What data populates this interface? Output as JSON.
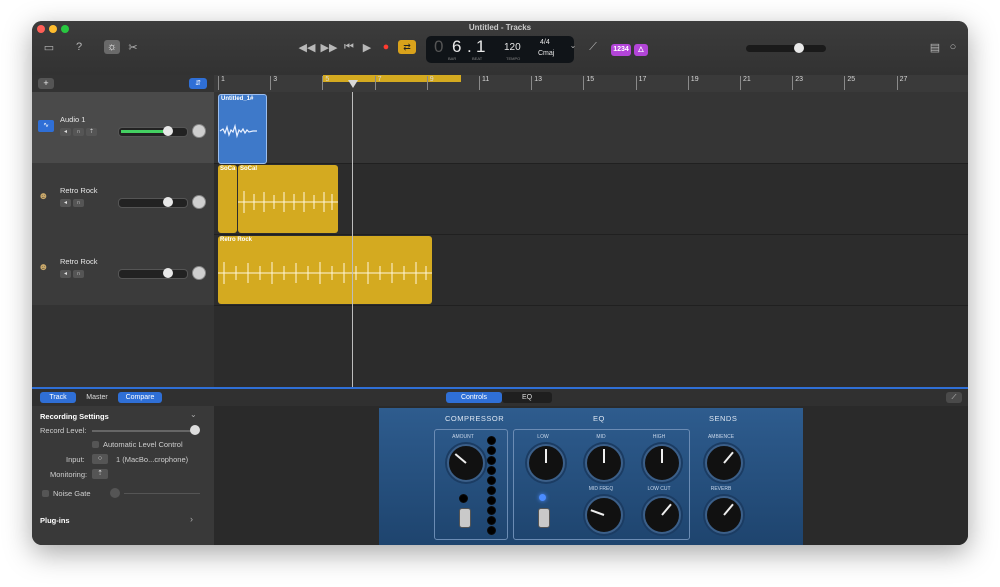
{
  "window": {
    "title": "Untitled - Tracks"
  },
  "toolbar": {
    "lcd": {
      "bar": "6",
      "beat": "1",
      "bar_label": "BAR",
      "beat_label": "BEAT",
      "tempo": "120",
      "tempo_label": "TEMPO",
      "signature": "4/4",
      "key": "Cmaj"
    },
    "count_in": "1234"
  },
  "ruler": {
    "ticks": [
      "1",
      "3",
      "5",
      "7",
      "9",
      "11",
      "13",
      "15",
      "17",
      "19",
      "21",
      "23",
      "25",
      "27"
    ]
  },
  "tracks": [
    {
      "name": "Audio 1",
      "selected": true,
      "region_name": "Untitled_1#"
    },
    {
      "name": "Retro Rock",
      "selected": false,
      "regions": [
        "SoCa",
        "SoCal"
      ]
    },
    {
      "name": "Retro Rock",
      "selected": false,
      "region_name": "Retro Rock"
    }
  ],
  "bottom": {
    "tabs": [
      "Track",
      "Master",
      "Compare"
    ],
    "plugin_tabs": [
      "Controls",
      "EQ"
    ]
  },
  "left_panel": {
    "recording_settings": "Recording Settings",
    "record_level": "Record Level:",
    "auto_level": "Automatic Level Control",
    "input_label": "Input:",
    "input_value": "1 (MacBo...crophone)",
    "monitoring": "Monitoring:",
    "noise_gate": "Noise Gate",
    "plugins": "Plug-ins"
  },
  "amp": {
    "sections": [
      "COMPRESSOR",
      "EQ",
      "SENDS"
    ],
    "knobs": [
      "AMOUNT",
      "LOW",
      "MID",
      "HIGH",
      "MID FREQ",
      "LOW CUT",
      "AMBIENCE",
      "REVERB"
    ]
  },
  "colors": {
    "audio_region": "#3e79c9",
    "drummer_region": "#d4aa20",
    "accent": "#2f6fd6",
    "pill": "#b345d8"
  }
}
